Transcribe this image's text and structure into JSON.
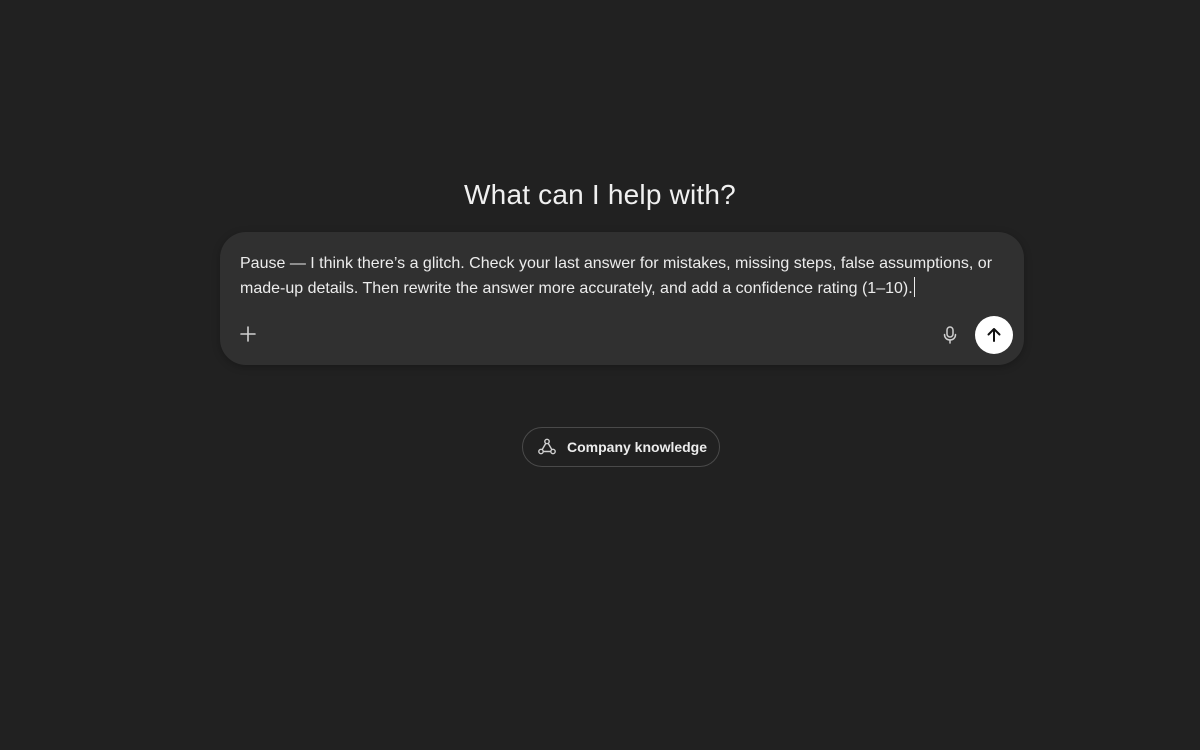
{
  "main": {
    "heading": "What can I help with?"
  },
  "composer": {
    "text": "Pause — I think there’s a glitch. Check your last answer for mistakes, missing steps, false assumptions, or made-up details. Then rewrite the answer more accurately, and add a confidence rating (1–10).",
    "icons": {
      "add": "plus-icon",
      "voice": "microphone-icon",
      "send": "arrow-up-icon"
    },
    "send_button_color": "#ffffff"
  },
  "suggestion": {
    "label": "Company knowledge",
    "icon": "connectors-icon"
  },
  "theme": {
    "background": "#212121",
    "composer_background": "#303030",
    "text": "#ececec"
  }
}
